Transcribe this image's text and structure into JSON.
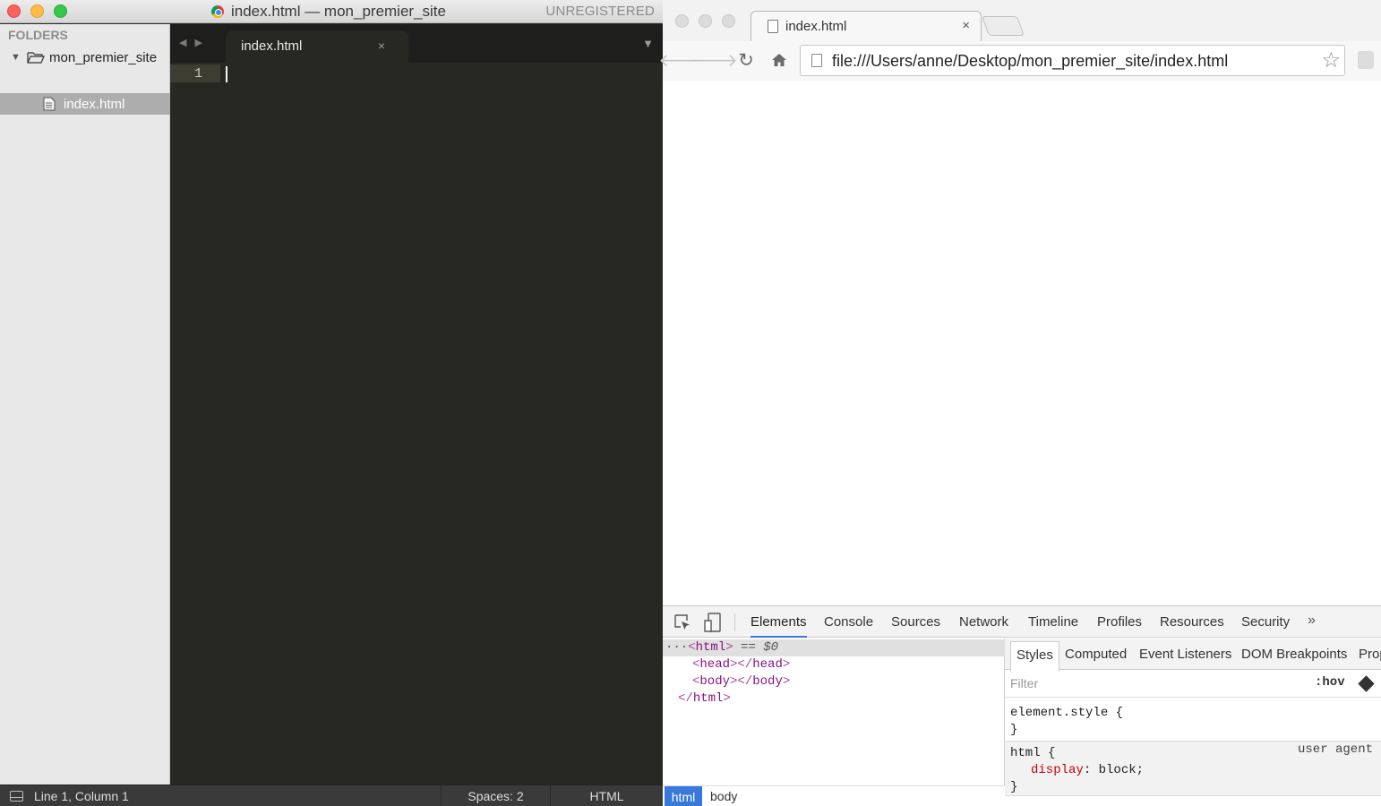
{
  "sublime": {
    "window_title": "index.html — mon_premier_site",
    "unregistered_label": "UNREGISTERED",
    "sidebar": {
      "folders_label": "FOLDERS",
      "folder_name": "mon_premier_site",
      "file_name": "index.html"
    },
    "tab": {
      "label": "index.html",
      "close_glyph": "×"
    },
    "editor": {
      "line_number": "1"
    },
    "status": {
      "position": "Line 1, Column 1",
      "indentation": "Spaces: 2",
      "syntax": "HTML"
    }
  },
  "chrome": {
    "tab": {
      "label": "index.html",
      "close_glyph": "×"
    },
    "address_bar": {
      "url": "file:///Users/anne/Desktop/mon_premier_site/index.html"
    },
    "devtools": {
      "tabs": [
        "Elements",
        "Console",
        "Sources",
        "Network",
        "Timeline",
        "Profiles",
        "Resources",
        "Security"
      ],
      "active_tab": "Elements",
      "more_glyph": "»",
      "dom": {
        "selected_marker": "== $0"
      },
      "breadcrumb": [
        "html",
        "body"
      ],
      "styles_tabs": [
        "Styles",
        "Computed",
        "Event Listeners",
        "DOM Breakpoints",
        "Prop"
      ],
      "filter_placeholder": "Filter",
      "hov_label": ":hov",
      "rules": {
        "element_style": "element.style {",
        "close_brace": "}",
        "html_selector": "html {",
        "html_prop": "display",
        "html_value": " block;",
        "user_agent_label": "user agent"
      }
    }
  },
  "colors": {
    "editor_bg": "#272822",
    "sidebar_bg": "#e8e8e8",
    "devtools_accent": "#3879d9",
    "dom_tag": "#881280",
    "css_prop": "#c80000"
  }
}
